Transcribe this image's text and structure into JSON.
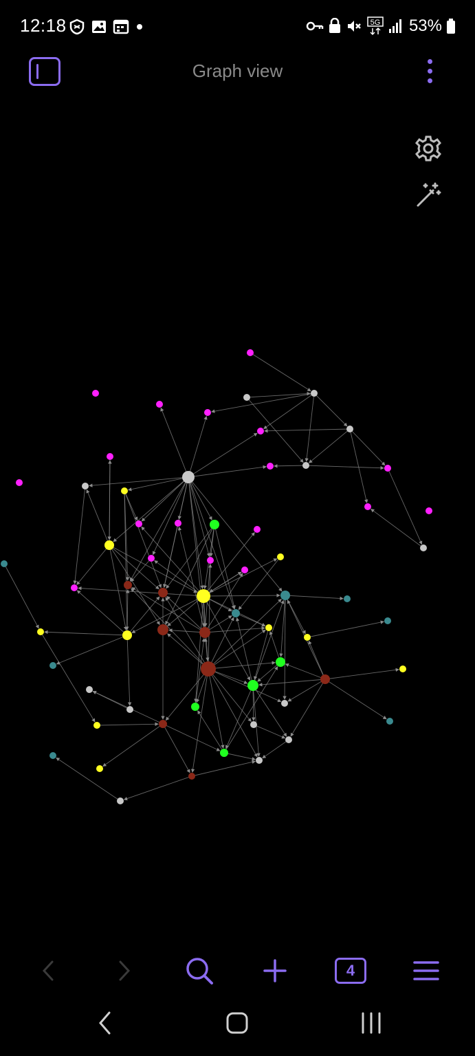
{
  "status_bar": {
    "time": "12:18",
    "battery": "53%",
    "network": "5G"
  },
  "header": {
    "title": "Graph view"
  },
  "icons": {
    "sidebar": "sidebar-toggle-icon",
    "more": "more-vertical-icon",
    "settings": "gear-icon",
    "animate": "magic-wand-icon",
    "back": "chevron-left-icon",
    "forward": "chevron-right-icon",
    "search": "search-icon",
    "new": "plus-icon",
    "menu": "hamburger-menu-icon"
  },
  "toolbar": {
    "tab_count": "4"
  },
  "colors": {
    "accent": "#8b6cf0",
    "node_default": "#c8c8c8",
    "node_magenta": "#ff20ff",
    "node_yellow": "#ffff20",
    "node_green": "#20ff20",
    "node_teal": "#3a8a8f",
    "node_red": "#8b2818",
    "edge": "#8a8a8a"
  }
}
